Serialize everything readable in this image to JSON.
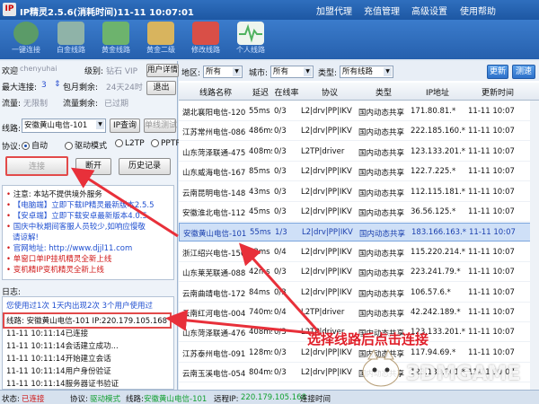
{
  "window": {
    "title": "IP精灵2.5.6(消耗时间)11-11 10:07:01",
    "menu": [
      "加盟代理",
      "充值管理",
      "高级设置",
      "使用帮助"
    ]
  },
  "toolbar": [
    {
      "label": "一键连接",
      "icon": "globe-icon",
      "color": "#5b9b68"
    },
    {
      "label": "白金线路",
      "icon": "user-platinum-icon",
      "color": "#8fb3a8"
    },
    {
      "label": "黄金线路",
      "icon": "user-gold-icon",
      "color": "#6db36d"
    },
    {
      "label": "黄金二级",
      "icon": "gear-box-icon",
      "color": "#d8b45e"
    },
    {
      "label": "修改线路",
      "icon": "document-icon",
      "color": "#d94f47"
    },
    {
      "label": "个人线路",
      "icon": "pulse-icon",
      "color": "#4fb25f"
    }
  ],
  "account": {
    "welcome_label": "欢迎",
    "username": "chenyuhai",
    "level_label": "级别:",
    "level_value": "钻石 VIP",
    "user_detail_button": "用户详情",
    "max_conn_label": "最大连接:",
    "max_conn_value": "3",
    "monthly_label": "包月剩余:",
    "monthly_value": "24天24时",
    "logout_button": "退出",
    "traffic_label": "流量:",
    "traffic_value": "无限制",
    "traffic_left_label": "流量剩余:",
    "traffic_left_value": "已过期"
  },
  "connection": {
    "line_label": "线路:",
    "line_value": "安徽黄山电信-101",
    "ip_query_button": "IP查询",
    "test_button": "单线测试",
    "protocol_label": "协议:",
    "protocols": [
      "自动",
      "驱动模式",
      "L2TP",
      "PPTP"
    ],
    "selected_protocol": "自动",
    "connect_button": "连接",
    "disconnect_button": "断开",
    "history_button": "历史记录"
  },
  "news": [
    {
      "text": "注意: 本站不提供境外服务",
      "color": "#111111"
    },
    {
      "text": "【电脑端】立即下载IP精灵最新版本2.5.5",
      "color": "#1f4fd0"
    },
    {
      "text": "【安卓端】立即下载安卓最新版本4.0.5",
      "color": "#1f4fd0"
    },
    {
      "text": "国庆中秋期间客服人员较少,如响应慢敬",
      "color": "#1f4fd0"
    },
    {
      "text": "请谅解!",
      "color": "#1f4fd0"
    },
    {
      "text": "官网地址: http://www.djjl11.com",
      "color": "#1f4fd0"
    },
    {
      "text": "单窗口单IP挂机精灵全新上线",
      "color": "#d01818"
    },
    {
      "text": "变机精IP变机精灵全新上线",
      "color": "#d01818"
    }
  ],
  "log": {
    "title": "日志:",
    "lines": [
      "您使用过1次 1天内出现2次 3个用户使用过",
      "线路: 安徽黄山电信-101 IP:220.179.105.168",
      "11-11 10:11:14已连接",
      "11-11 10:11:14会话建立成功...",
      "11-11 10:11:14开始建立会话",
      "11-11 10:11:14用户身份验证",
      "11-11 10:11:14服务器证书验证"
    ]
  },
  "filters": {
    "region_label": "地区:",
    "region_value": "所有",
    "city_label": "城市:",
    "city_value": "所有",
    "type_label": "类型:",
    "type_value": "所有线路",
    "refresh_button": "更新",
    "test_button": "测速"
  },
  "table": {
    "columns": [
      "线路名称",
      "延迟",
      "在线率",
      "协议",
      "类型",
      "IP地址",
      "更新时间"
    ],
    "rows": [
      [
        "湖北襄阳电信-120",
        "55ms",
        "0/3",
        "L2|drv|PP|IKV",
        "国内动态共享",
        "171.80.81.*",
        "11-11 10:07"
      ],
      [
        "江苏常州电信-086",
        "486ms",
        "0/3",
        "L2|drv|PP|IKV",
        "国内动态共享",
        "222.185.160.*",
        "11-11 10:07"
      ],
      [
        "山东菏泽联通-475",
        "408ms",
        "0/3",
        "L2TP|driver",
        "国内动态共享",
        "123.133.201.*",
        "11-11 10:07"
      ],
      [
        "山东威海电信-167",
        "85ms",
        "0/3",
        "L2|drv|PP|IKV",
        "国内动态共享",
        "122.7.225.*",
        "11-11 10:07"
      ],
      [
        "云南昆明电信-148",
        "43ms",
        "0/3",
        "L2|drv|PP|IKV",
        "国内动态共享",
        "112.115.181.*",
        "11-11 10:07"
      ],
      [
        "安徽淮北电信-112",
        "45ms",
        "0/3",
        "L2|drv|PP|IKV",
        "国内动态共享",
        "36.56.125.*",
        "11-11 10:07"
      ],
      [
        "安徽黄山电信-101",
        "55ms",
        "1/3",
        "L2|drv|PP|IKV",
        "国内动态共享",
        "183.166.163.*",
        "11-11 10:07"
      ],
      [
        "浙江绍兴电信-156",
        "33ms",
        "0/4",
        "L2|drv|PP|IKV",
        "国内动态共享",
        "115.220.214.*",
        "11-11 10:07"
      ],
      [
        "山东莱芜联通-088",
        "42ms",
        "0/3",
        "L2|drv|PP|IKV",
        "国内动态共享",
        "223.241.79.*",
        "11-11 10:07"
      ],
      [
        "云南曲靖电信-172",
        "84ms",
        "0/3",
        "L2|drv|PP|IKV",
        "国内动态共享",
        "106.57.6.*",
        "11-11 10:07"
      ],
      [
        "云南红河电信-004",
        "740ms",
        "0/4",
        "L2TP|driver",
        "国内动态共享",
        "42.242.189.*",
        "11-11 10:07"
      ],
      [
        "山东菏泽联通-476",
        "408ms",
        "0/3",
        "L2TP|driver",
        "国内动态共享",
        "123.133.201.*",
        "11-11 10:07"
      ],
      [
        "江苏泰州电信-091",
        "128ms",
        "0/3",
        "L2|drv|PP|IKV",
        "国内动态共享",
        "117.94.69.*",
        "11-11 10:07"
      ],
      [
        "云南玉溪电信-054",
        "804ms",
        "0/3",
        "L2|drv|PP|IKV",
        "国内动态共享",
        "123.133.201.*",
        "11-11 10:07"
      ]
    ],
    "selected_row": 6
  },
  "status": {
    "state_label": "状态:",
    "state_value": "已连接",
    "protocol_label": "协议:",
    "protocol_value": "驱动模式",
    "line_label": "线路:",
    "line_value": "安徽黄山电信-101",
    "remote_ip_label": "远程IP:",
    "remote_ip_value": "220.179.105.168",
    "conn_time_label": "连接时间"
  },
  "annotation": {
    "text": "选择线路后点击连接",
    "color": "#e0202a"
  },
  "watermark": "3DMGAME"
}
